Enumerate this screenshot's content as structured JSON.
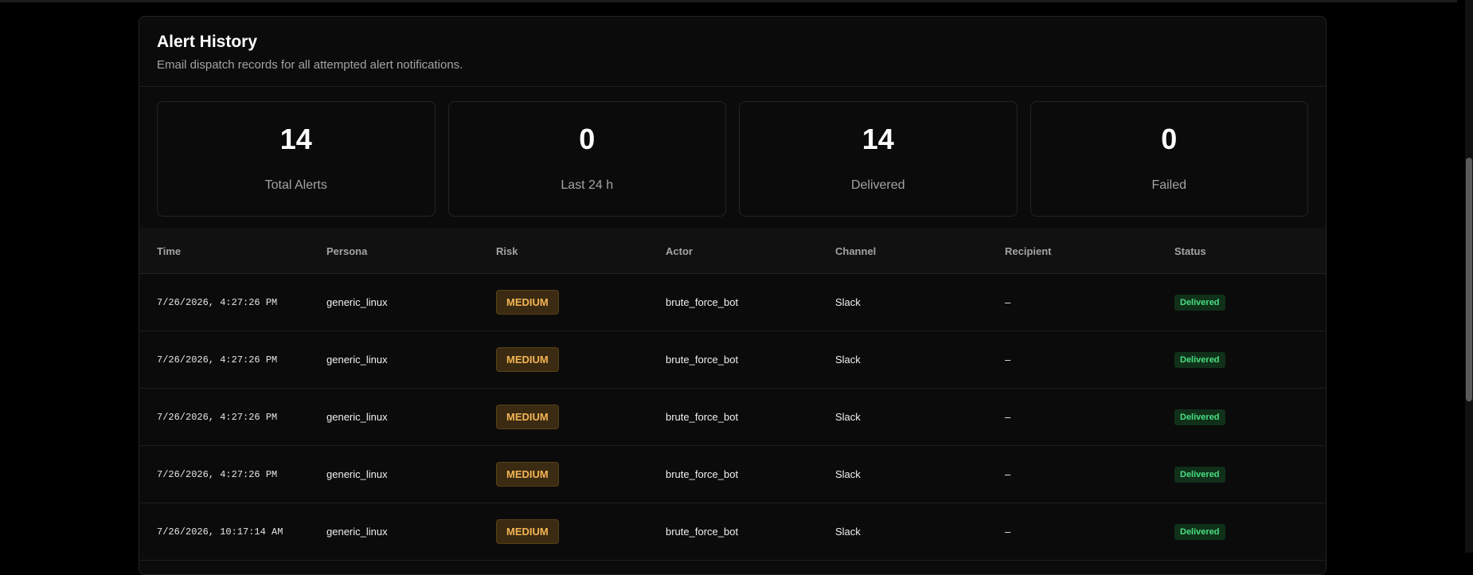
{
  "header": {
    "title": "Alert History",
    "subtitle": "Email dispatch records for all attempted alert notifications."
  },
  "stats": [
    {
      "value": "14",
      "label": "Total Alerts"
    },
    {
      "value": "0",
      "label": "Last 24 h"
    },
    {
      "value": "14",
      "label": "Delivered"
    },
    {
      "value": "0",
      "label": "Failed"
    }
  ],
  "table": {
    "columns": [
      "Time",
      "Persona",
      "Risk",
      "Actor",
      "Channel",
      "Recipient",
      "Status"
    ],
    "rows": [
      {
        "time": "7/26/2026, 4:27:26 PM",
        "persona": "generic_linux",
        "risk": "MEDIUM",
        "actor": "brute_force_bot",
        "channel": "Slack",
        "recipient": "–",
        "status": "Delivered"
      },
      {
        "time": "7/26/2026, 4:27:26 PM",
        "persona": "generic_linux",
        "risk": "MEDIUM",
        "actor": "brute_force_bot",
        "channel": "Slack",
        "recipient": "–",
        "status": "Delivered"
      },
      {
        "time": "7/26/2026, 4:27:26 PM",
        "persona": "generic_linux",
        "risk": "MEDIUM",
        "actor": "brute_force_bot",
        "channel": "Slack",
        "recipient": "–",
        "status": "Delivered"
      },
      {
        "time": "7/26/2026, 4:27:26 PM",
        "persona": "generic_linux",
        "risk": "MEDIUM",
        "actor": "brute_force_bot",
        "channel": "Slack",
        "recipient": "–",
        "status": "Delivered"
      },
      {
        "time": "7/26/2026, 10:17:14 AM",
        "persona": "generic_linux",
        "risk": "MEDIUM",
        "actor": "brute_force_bot",
        "channel": "Slack",
        "recipient": "–",
        "status": "Delivered"
      }
    ]
  },
  "colors": {
    "risk_medium": "#f5b455",
    "status_delivered": "#4ade80"
  }
}
